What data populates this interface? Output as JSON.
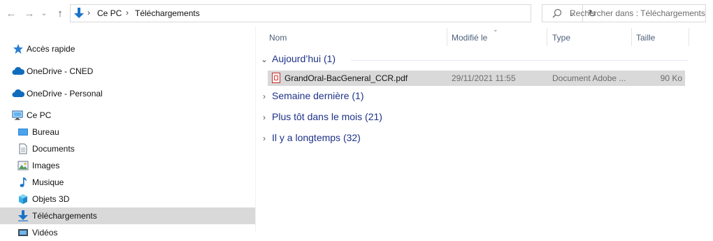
{
  "toolbar": {
    "back": "←",
    "forward": "→",
    "recent": "⌄",
    "up": "↑",
    "dropdown": "⌄",
    "refresh": "↻",
    "chevron": "›"
  },
  "address": {
    "parts": [
      "Ce PC",
      "Téléchargements"
    ]
  },
  "search": {
    "placeholder": "Rechercher dans : Téléchargements"
  },
  "nav": {
    "items": [
      {
        "label": "Accès rapide",
        "icon": "star-icon"
      },
      {
        "label": "OneDrive - CNED",
        "icon": "cloud-icon"
      },
      {
        "label": "OneDrive - Personal",
        "icon": "cloud-icon"
      },
      {
        "label": "Ce PC",
        "icon": "computer-icon"
      },
      {
        "label": "Bureau",
        "icon": "desktop-icon"
      },
      {
        "label": "Documents",
        "icon": "document-icon"
      },
      {
        "label": "Images",
        "icon": "image-icon"
      },
      {
        "label": "Musique",
        "icon": "music-icon"
      },
      {
        "label": "Objets 3D",
        "icon": "cube-icon"
      },
      {
        "label": "Téléchargements",
        "icon": "download-icon",
        "selected": true
      },
      {
        "label": "Vidéos",
        "icon": "video-icon"
      }
    ]
  },
  "columns": {
    "name": "Nom",
    "modified": "Modifié le",
    "type": "Type",
    "size": "Taille"
  },
  "groups": [
    {
      "label": "Aujourd’hui (1)",
      "expanded": true
    },
    {
      "label": "Semaine dernière (1)",
      "expanded": false
    },
    {
      "label": "Plus tôt dans le mois (21)",
      "expanded": false
    },
    {
      "label": "Il y a longtemps (32)",
      "expanded": false
    }
  ],
  "file": {
    "name": "GrandOral-BacGeneral_CCR.pdf",
    "modified": "29/11/2021 11:55",
    "type": "Document Adobe ...",
    "size": "90 Ko",
    "icon": "pdf-icon"
  },
  "colors": {
    "selected_bg": "#d9d9d9",
    "group_text": "#1e3287",
    "accent": "#1a73c9"
  }
}
